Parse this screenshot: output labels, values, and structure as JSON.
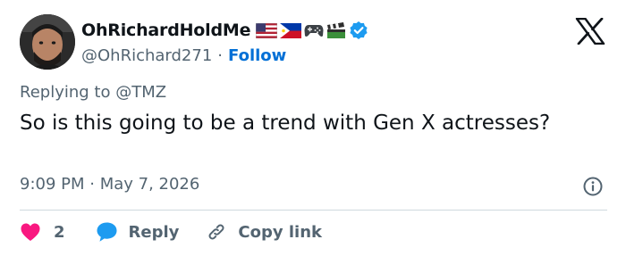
{
  "author": {
    "display_name": "OhRichardHoldMe",
    "handle": "@OhRichard271",
    "separator": "·",
    "follow_label": "Follow",
    "badges": [
      "us-flag-icon",
      "philippines-flag-icon",
      "gamepad-icon",
      "clapperboard-icon",
      "verified-badge-icon"
    ],
    "verified_color": "#1d9bf0"
  },
  "tweet": {
    "replying_to": "Replying to @TMZ",
    "text": "So is this going to be a trend with Gen X actresses?",
    "timestamp": "9:09 PM · May 7, 2026"
  },
  "actions": {
    "like_count": "2",
    "reply_label": "Reply",
    "copy_link_label": "Copy link"
  },
  "colors": {
    "link": "#006fd6",
    "muted": "#536471",
    "text": "#0f1419",
    "like": "#f91880",
    "reply": "#1d9bf0",
    "divider": "#cfd9de"
  }
}
